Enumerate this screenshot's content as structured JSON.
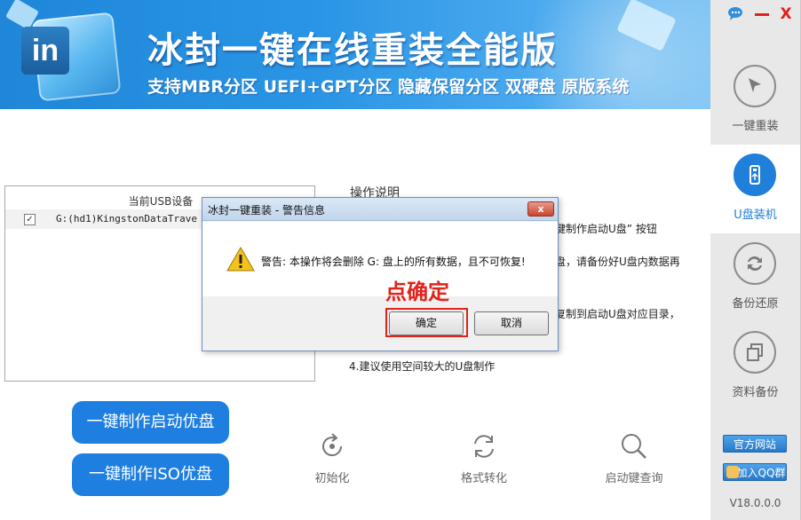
{
  "window": {
    "title": "冰封一键在线重装全能版",
    "subtitle": "支持MBR分区  UEFI+GPT分区  隐藏保留分区  双硬盘  原版系统",
    "logo_text": "in",
    "controls": {
      "minimize_icon": "minimize-icon",
      "close_label": "X"
    }
  },
  "sidebar": {
    "items": [
      {
        "label": "一键重装",
        "icon": "cursor-arrow-icon",
        "active": false
      },
      {
        "label": "U盘装机",
        "icon": "usb-icon",
        "active": true
      },
      {
        "label": "备份还原",
        "icon": "sync-arrows-icon",
        "active": false
      },
      {
        "label": "资料备份",
        "icon": "copy-icon",
        "active": false
      }
    ],
    "site_button": "官方网站",
    "qq_button": "加入QQ群",
    "version": "V18.0.0.0"
  },
  "usb_panel": {
    "header": "当前USB设备",
    "devices": [
      {
        "checked": true,
        "name": "G:(hd1)KingstonDataTrave"
      }
    ]
  },
  "instructions": {
    "title": "操作说明",
    "lines": [
      "键制作启动U盘” 按钮",
      "盘，请备份好U盘内数据再",
      "复制到启动U盘对应目录，",
      "4.建议使用空间较大的U盘制作"
    ]
  },
  "actions": {
    "make_boot_usb": "一键制作启动优盘",
    "make_iso_usb": "一键制作ISO优盘",
    "tools": [
      {
        "label": "初始化",
        "icon": "refresh-dot-icon"
      },
      {
        "label": "格式转化",
        "icon": "convert-arrows-icon"
      },
      {
        "label": "启动键查询",
        "icon": "magnifier-icon"
      }
    ]
  },
  "dialog": {
    "title": "冰封一键重装 - 警告信息",
    "message": "警告: 本操作将会删除 G: 盘上的所有数据，且不可恢复!",
    "hint": "点确定",
    "ok_label": "确定",
    "cancel_label": "取消",
    "close_label": "x"
  },
  "colors": {
    "brand_blue": "#1f7fe0",
    "hint_red": "#e0231b",
    "sidebar_bg": "#e8e8e8"
  }
}
